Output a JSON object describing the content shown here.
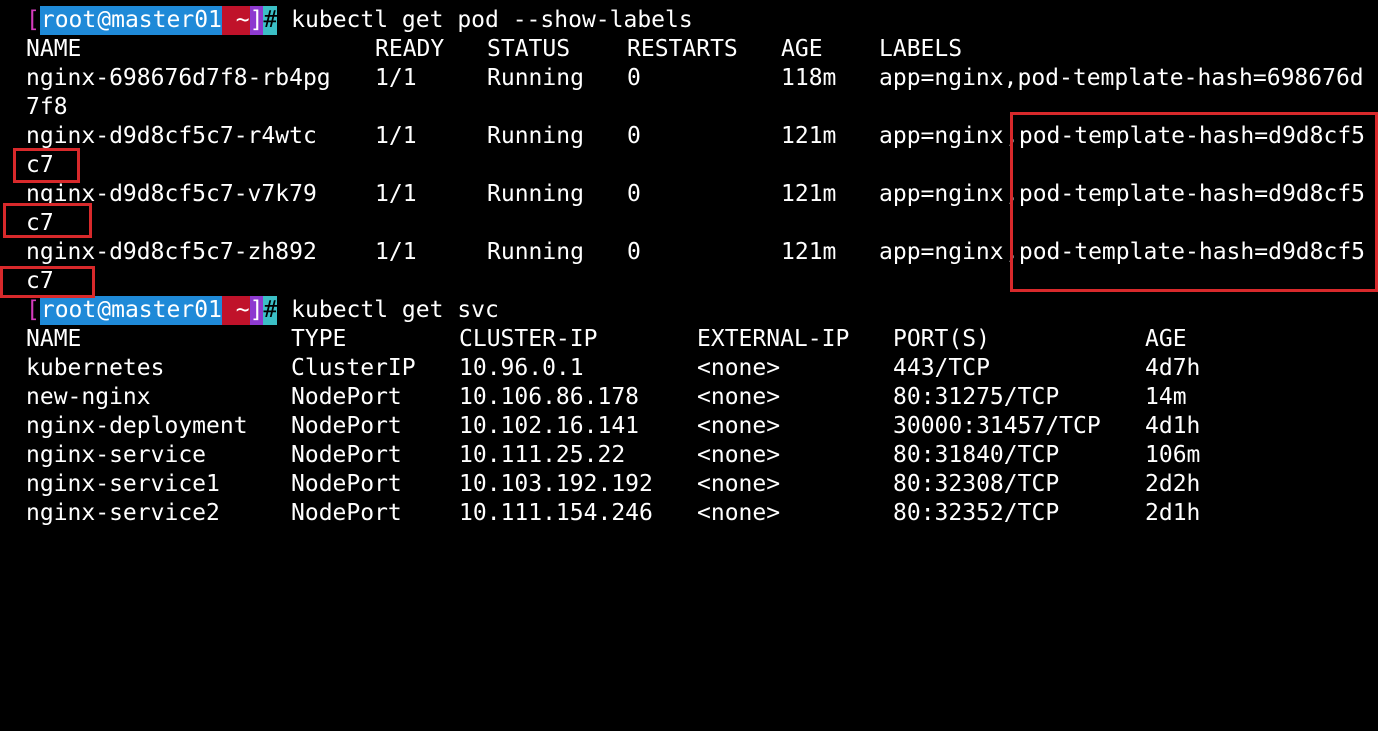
{
  "prompt": {
    "open": "[",
    "user": "root",
    "at": "@",
    "host": "master01",
    "dir": " ~",
    "close": "]",
    "hash": "#"
  },
  "commands": {
    "get_pod": " kubectl get pod --show-labels",
    "get_svc": " kubectl get svc"
  },
  "pods": {
    "headers": [
      "NAME",
      "READY",
      "STATUS",
      "RESTARTS",
      "AGE",
      "LABELS"
    ],
    "rows": [
      {
        "name": "nginx-698676d7f8-rb4pg",
        "ready": "1/1",
        "status": "Running",
        "restarts": "0",
        "age": "118m",
        "labels": "app=nginx,pod-template-hash=698676d",
        "wrap": "7f8"
      },
      {
        "name": "nginx-d9d8cf5c7-r4wtc",
        "ready": "1/1",
        "status": "Running",
        "restarts": "0",
        "age": "121m",
        "labels_a": "app=nginx",
        "labels_b": ",pod-template-hash=d9d8cf5",
        "wrap": "c7"
      },
      {
        "name": "nginx-d9d8cf5c7-v7k79",
        "ready": "1/1",
        "status": "Running",
        "restarts": "0",
        "age": "121m",
        "labels_a": "app=nginx",
        "labels_b": ",pod-template-hash=d9d8cf5",
        "wrap": "c7"
      },
      {
        "name": "nginx-d9d8cf5c7-zh892",
        "ready": "1/1",
        "status": "Running",
        "restarts": "0",
        "age": "121m",
        "labels_a": "app=nginx",
        "labels_b": ",pod-template-hash=d9d8cf5",
        "wrap": "c7"
      }
    ]
  },
  "svc": {
    "headers": [
      "NAME",
      "TYPE",
      "CLUSTER-IP",
      "EXTERNAL-IP",
      "PORT(S)",
      "AGE"
    ],
    "rows": [
      {
        "name": "kubernetes",
        "type": "ClusterIP",
        "ip": "10.96.0.1",
        "ext": "<none>",
        "ports": "443/TCP",
        "age": "4d7h"
      },
      {
        "name": "new-nginx",
        "type": "NodePort",
        "ip": "10.106.86.178",
        "ext": "<none>",
        "ports": "80:31275/TCP",
        "age": "14m"
      },
      {
        "name": "nginx-deployment",
        "type": "NodePort",
        "ip": "10.102.16.141",
        "ext": "<none>",
        "ports": "30000:31457/TCP",
        "age": "4d1h"
      },
      {
        "name": "nginx-service",
        "type": "NodePort",
        "ip": "10.111.25.22",
        "ext": "<none>",
        "ports": "80:31840/TCP",
        "age": "106m"
      },
      {
        "name": "nginx-service1",
        "type": "NodePort",
        "ip": "10.103.192.192",
        "ext": "<none>",
        "ports": "80:32308/TCP",
        "age": "2d2h"
      },
      {
        "name": "nginx-service2",
        "type": "NodePort",
        "ip": "10.111.154.246",
        "ext": "<none>",
        "ports": "80:32352/TCP",
        "age": "2d1h"
      }
    ]
  },
  "highlight_color": "#d8292b"
}
